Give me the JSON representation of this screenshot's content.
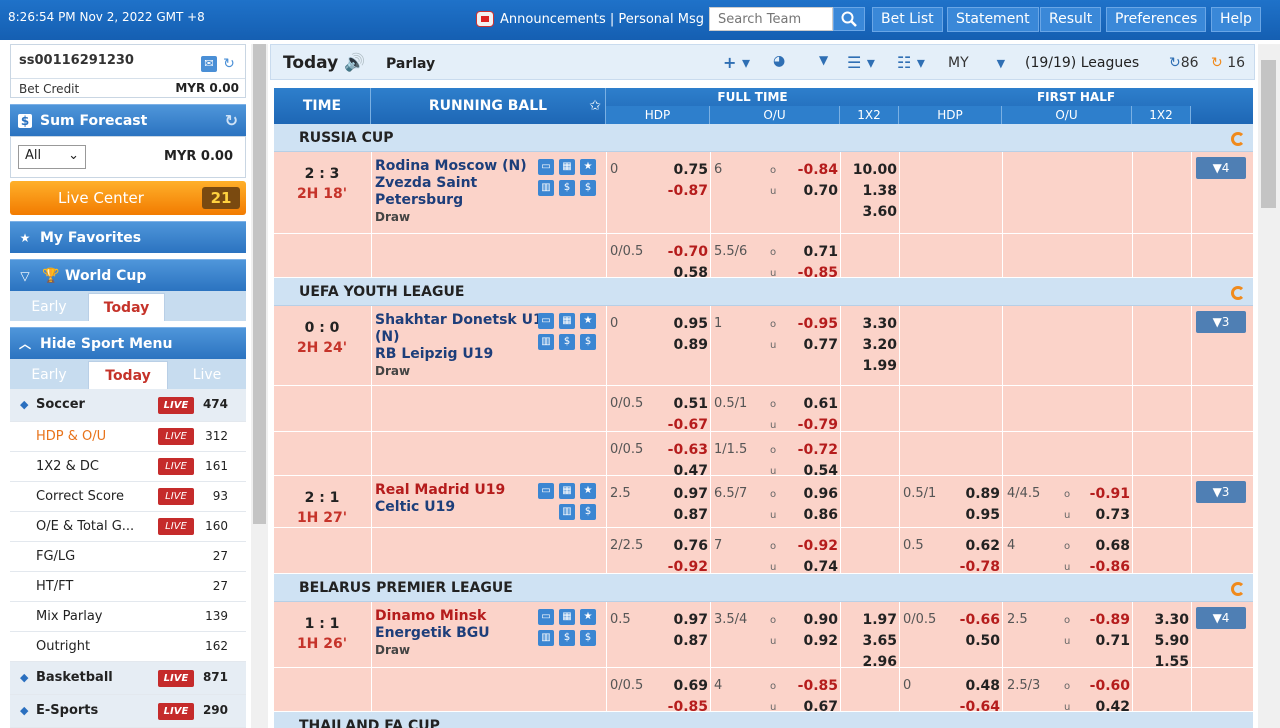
{
  "header": {
    "clock": "8:26:54 PM Nov 2, 2022 GMT +8",
    "announcements": "Announcements | Personal Msg",
    "search_placeholder": "Search Team",
    "nav": [
      "Bet List",
      "Statement",
      "Result",
      "Preferences",
      "Help"
    ]
  },
  "account": {
    "id": "ss00116291230",
    "bet_credit_label": "Bet Credit",
    "bet_credit_value": "MYR  0.00"
  },
  "sum_forecast": {
    "title": "Sum Forecast",
    "select": "All",
    "value": "MYR 0.00"
  },
  "live_center": {
    "label": "Live Center",
    "count": "21"
  },
  "favorites": {
    "label": "My Favorites"
  },
  "world_cup": {
    "label": "World Cup",
    "tabs": [
      "Early",
      "Today"
    ]
  },
  "sport_menu": {
    "label": "Hide Sport Menu",
    "tabs": [
      "Early",
      "Today",
      "Live"
    ],
    "items": [
      {
        "name": "Soccer",
        "live": "LIVE",
        "count": "474",
        "main": true
      },
      {
        "name": "HDP & O/U",
        "live": "LIVE",
        "count": "312",
        "active": true
      },
      {
        "name": "1X2 & DC",
        "live": "LIVE",
        "count": "161"
      },
      {
        "name": "Correct Score",
        "live": "LIVE",
        "count": "93"
      },
      {
        "name": "O/E & Total G...",
        "live": "LIVE",
        "count": "160"
      },
      {
        "name": "FG/LG",
        "live": "",
        "count": "27"
      },
      {
        "name": "HT/FT",
        "live": "",
        "count": "27"
      },
      {
        "name": "Mix Parlay",
        "live": "",
        "count": "139"
      },
      {
        "name": "Outright",
        "live": "",
        "count": "162"
      },
      {
        "name": "Basketball",
        "live": "LIVE",
        "count": "871",
        "main": true
      },
      {
        "name": "E-Sports",
        "live": "LIVE",
        "count": "290",
        "main": true
      }
    ]
  },
  "toolbar": {
    "title": "Today",
    "parlay": "Parlay",
    "odds_type": "MY",
    "leagues": "(19/19) Leagues",
    "count_a": "86",
    "count_b": "16"
  },
  "table_header": {
    "time": "TIME",
    "running": "RUNNING BALL",
    "full_time": "FULL TIME",
    "first_half": "FIRST HALF",
    "sub": [
      "HDP",
      "O/U",
      "1X2",
      "HDP",
      "O/U",
      "1X2"
    ]
  },
  "leagues": [
    {
      "name": "RUSSIA CUP"
    },
    {
      "name": "UEFA YOUTH LEAGUE"
    },
    {
      "name": "BELARUS PREMIER LEAGUE"
    },
    {
      "name": "THAILAND FA CUP"
    }
  ],
  "matches": {
    "m1": {
      "score": "2 : 3",
      "time": "2H 18'",
      "home": "Rodina Moscow (N)",
      "away": "Zvezda Saint",
      "away2": "Petersburg",
      "draw": "Draw",
      "more": "▼4",
      "r1": {
        "hdp": "0",
        "h1": "0.75",
        "h2": "-0.87",
        "ou": "6",
        "o1": "-0.84",
        "o2": "0.70",
        "x1": "10.00",
        "x2": "1.38",
        "x3": "3.60"
      },
      "r2": {
        "hdp": "0/0.5",
        "h1": "-0.70",
        "h2": "0.58",
        "ou": "5.5/6",
        "o1": "0.71",
        "o2": "-0.85"
      }
    },
    "m2": {
      "score": "0 : 0",
      "time": "2H 24'",
      "home": "Shakhtar Donetsk U19",
      "home2": "(N)",
      "away": "RB Leipzig U19",
      "draw": "Draw",
      "more": "▼3",
      "r1": {
        "hdp": "0",
        "h1": "0.95",
        "h2": "0.89",
        "ou": "1",
        "o1": "-0.95",
        "o2": "0.77",
        "x1": "3.30",
        "x2": "3.20",
        "x3": "1.99"
      },
      "r2": {
        "hdp": "0/0.5",
        "h1": "0.51",
        "h2": "-0.67",
        "ou": "0.5/1",
        "o1": "0.61",
        "o2": "-0.79"
      },
      "r3": {
        "hdp": "0/0.5",
        "h1": "-0.63",
        "h2": "0.47",
        "ou": "1/1.5",
        "o1": "-0.72",
        "o2": "0.54"
      }
    },
    "m3": {
      "score": "2 : 1",
      "time": "1H 27'",
      "home": "Real Madrid U19",
      "away": "Celtic U19",
      "more": "▼3",
      "r1": {
        "hdp": "2.5",
        "h1": "0.97",
        "h2": "0.87",
        "ou": "6.5/7",
        "o1": "0.96",
        "o2": "0.86",
        "fhdp": "0.5/1",
        "f1": "0.89",
        "f2": "0.95",
        "fou": "4/4.5",
        "fo1": "-0.91",
        "fo2": "0.73"
      },
      "r2": {
        "hdp": "2/2.5",
        "h1": "0.76",
        "h2": "-0.92",
        "ou": "7",
        "o1": "-0.92",
        "o2": "0.74",
        "fhdp": "0.5",
        "f1": "0.62",
        "f2": "-0.78",
        "fou": "4",
        "fo1": "0.68",
        "fo2": "-0.86"
      }
    },
    "m4": {
      "score": "1 : 1",
      "time": "1H 26'",
      "home": "Dinamo Minsk",
      "away": "Energetik BGU",
      "draw": "Draw",
      "more": "▼4",
      "r1": {
        "hdp": "0.5",
        "h1": "0.97",
        "h2": "0.87",
        "ou": "3.5/4",
        "o1": "0.90",
        "o2": "0.92",
        "x1": "1.97",
        "x2": "3.65",
        "x3": "2.96",
        "fhdp": "0/0.5",
        "f1": "-0.66",
        "f2": "0.50",
        "fou": "2.5",
        "fo1": "-0.89",
        "fo2": "0.71",
        "fx1": "3.30",
        "fx2": "5.90",
        "fx3": "1.55"
      },
      "r2": {
        "hdp": "0/0.5",
        "h1": "0.69",
        "h2": "-0.85",
        "ou": "4",
        "o1": "-0.85",
        "o2": "0.67",
        "fhdp": "0",
        "f1": "0.48",
        "f2": "-0.64",
        "fou": "2.5/3",
        "fo1": "-0.60",
        "fo2": "0.42"
      }
    }
  },
  "ou_labels": {
    "o": "o",
    "u": "u"
  }
}
